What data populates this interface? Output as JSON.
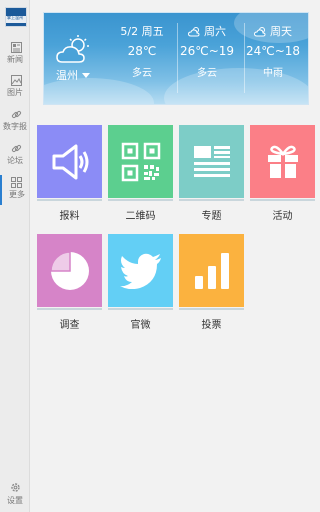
{
  "sidebar": {
    "logo_text": "掌上温州",
    "items": [
      {
        "label": "新闻",
        "icon": "news-icon"
      },
      {
        "label": "图片",
        "icon": "image-icon"
      },
      {
        "label": "数字报",
        "icon": "link-icon"
      },
      {
        "label": "论坛",
        "icon": "link-icon"
      },
      {
        "label": "更多",
        "icon": "grid-icon",
        "active": true
      }
    ],
    "settings_label": "设置"
  },
  "weather": {
    "city": "温州",
    "days": [
      {
        "day": "5/2  周五",
        "temp": "28℃",
        "cond": "多云"
      },
      {
        "day": "周六",
        "temp": "26℃~19",
        "cond": "多云"
      },
      {
        "day": "周天",
        "temp": "24℃~18",
        "cond": "中雨"
      }
    ]
  },
  "tiles": [
    {
      "label": "报料",
      "icon": "speaker-icon",
      "color": "#8b8cf6"
    },
    {
      "label": "二维码",
      "icon": "qr-code-icon",
      "color": "#5ccf8f"
    },
    {
      "label": "专题",
      "icon": "newspaper-icon",
      "color": "#7dcdc7"
    },
    {
      "label": "活动",
      "icon": "gift-icon",
      "color": "#fb7f87"
    },
    {
      "label": "调查",
      "icon": "pie-chart-icon",
      "color": "#d684c8"
    },
    {
      "label": "官微",
      "icon": "twitter-bird-icon",
      "color": "#63cff5"
    },
    {
      "label": "投票",
      "icon": "bar-chart-icon",
      "color": "#fbb23f"
    }
  ],
  "colors": {
    "accent": "#2a7fd0",
    "sidebar_bg": "#ececec",
    "page_bg": "#f2f2f2"
  }
}
